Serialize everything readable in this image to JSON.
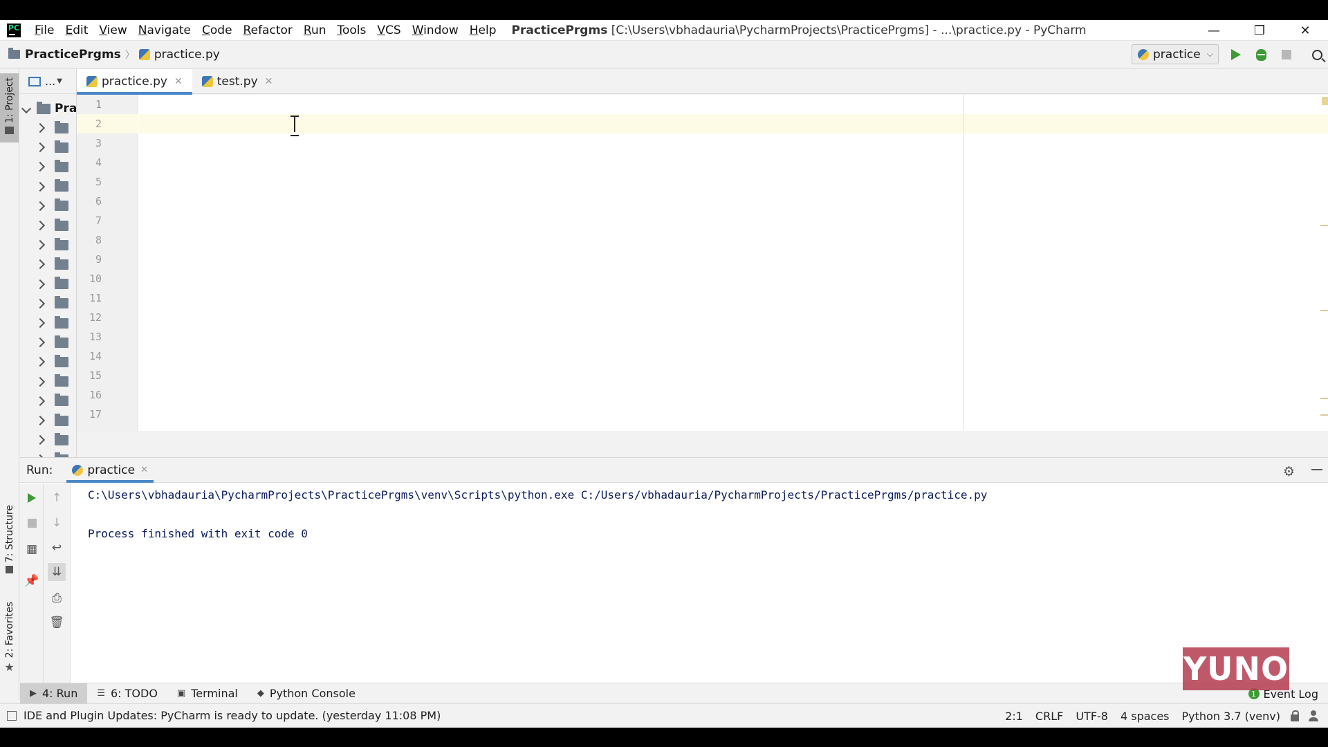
{
  "window": {
    "project_bold": "PracticePrgms",
    "title_rest": "[C:\\Users\\vbhadauria\\PycharmProjects\\PracticePrgms] - ...\\practice.py - PyCharm",
    "minimize": "—",
    "restore": "❐",
    "close": "✕"
  },
  "menu": [
    "File",
    "Edit",
    "View",
    "Navigate",
    "Code",
    "Refactor",
    "Run",
    "Tools",
    "VCS",
    "Window",
    "Help"
  ],
  "breadcrumb": {
    "project": "PracticePrgms",
    "file": "practice.py"
  },
  "run_config": {
    "label": "practice"
  },
  "left_stripe": {
    "project": "1: Project",
    "structure": "7: Structure",
    "favorites": "2: Favorites"
  },
  "project_panel": {
    "dropdown": "...",
    "root_label": "Pra"
  },
  "tabs": [
    {
      "label": "practice.py",
      "close": "✕"
    },
    {
      "label": "test.py",
      "close": "✕"
    }
  ],
  "editor": {
    "line_numbers": [
      "1",
      "2",
      "3",
      "4",
      "5",
      "6",
      "7",
      "8",
      "9",
      "10",
      "11",
      "12",
      "13",
      "14",
      "15",
      "16",
      "17"
    ]
  },
  "run_panel": {
    "title": "Run:",
    "tab_label": "practice",
    "tab_close": "✕",
    "console_lines": [
      "C:\\Users\\vbhadauria\\PycharmProjects\\PracticePrgms\\venv\\Scripts\\python.exe C:/Users/vbhadauria/PycharmProjects/PracticePrgms/practice.py",
      "",
      "Process finished with exit code 0"
    ]
  },
  "tool_tabs": [
    {
      "label": "4: Run",
      "icon": "▶"
    },
    {
      "label": "6: TODO",
      "icon": "☰"
    },
    {
      "label": "Terminal",
      "icon": "▣"
    },
    {
      "label": "Python Console",
      "icon": "◆"
    }
  ],
  "event_log": {
    "count": "1",
    "label": "Event Log"
  },
  "status": {
    "message": "IDE and Plugin Updates: PyCharm is ready to update. (yesterday 11:08 PM)",
    "position": "2:1",
    "line_separator": "CRLF",
    "encoding": "UTF-8",
    "indent": "4 spaces",
    "interpreter": "Python 3.7 (venv)"
  },
  "watermark": {
    "text": "YUNO"
  },
  "colors": {
    "accent": "#4a88c7",
    "run_green": "#3d9b36",
    "current_line": "#fdfbe5"
  }
}
